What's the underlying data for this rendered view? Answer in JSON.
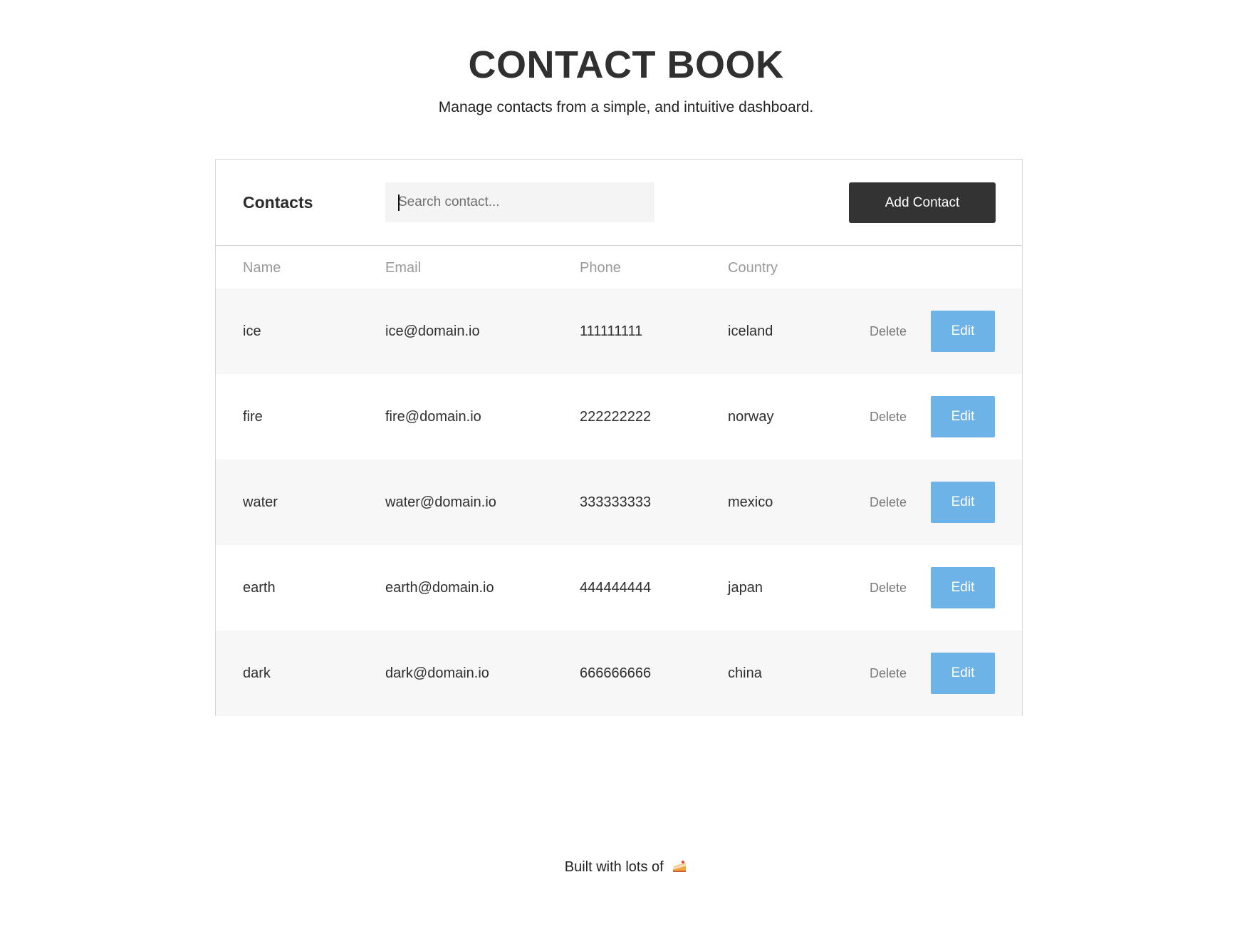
{
  "header": {
    "title": "CONTACT BOOK",
    "subtitle": "Manage contacts from a simple, and intuitive dashboard."
  },
  "card": {
    "title": "Contacts",
    "search_placeholder": "Search contact...",
    "add_button_label": "Add Contact"
  },
  "table": {
    "columns": [
      "Name",
      "Email",
      "Phone",
      "Country"
    ],
    "rows": [
      {
        "name": "ice",
        "email": "ice@domain.io",
        "phone": "111111111",
        "country": "iceland"
      },
      {
        "name": "fire",
        "email": "fire@domain.io",
        "phone": "222222222",
        "country": "norway"
      },
      {
        "name": "water",
        "email": "water@domain.io",
        "phone": "333333333",
        "country": "mexico"
      },
      {
        "name": "earth",
        "email": "earth@domain.io",
        "phone": "444444444",
        "country": "japan"
      },
      {
        "name": "dark",
        "email": "dark@domain.io",
        "phone": "666666666",
        "country": "china"
      }
    ],
    "delete_label": "Delete",
    "edit_label": "Edit"
  },
  "footer": {
    "text": "Built with lots of",
    "icon": "cake-icon"
  },
  "colors": {
    "primary_dark": "#333333",
    "edit_blue": "#6db3e8",
    "row_alt": "#f7f7f7"
  }
}
